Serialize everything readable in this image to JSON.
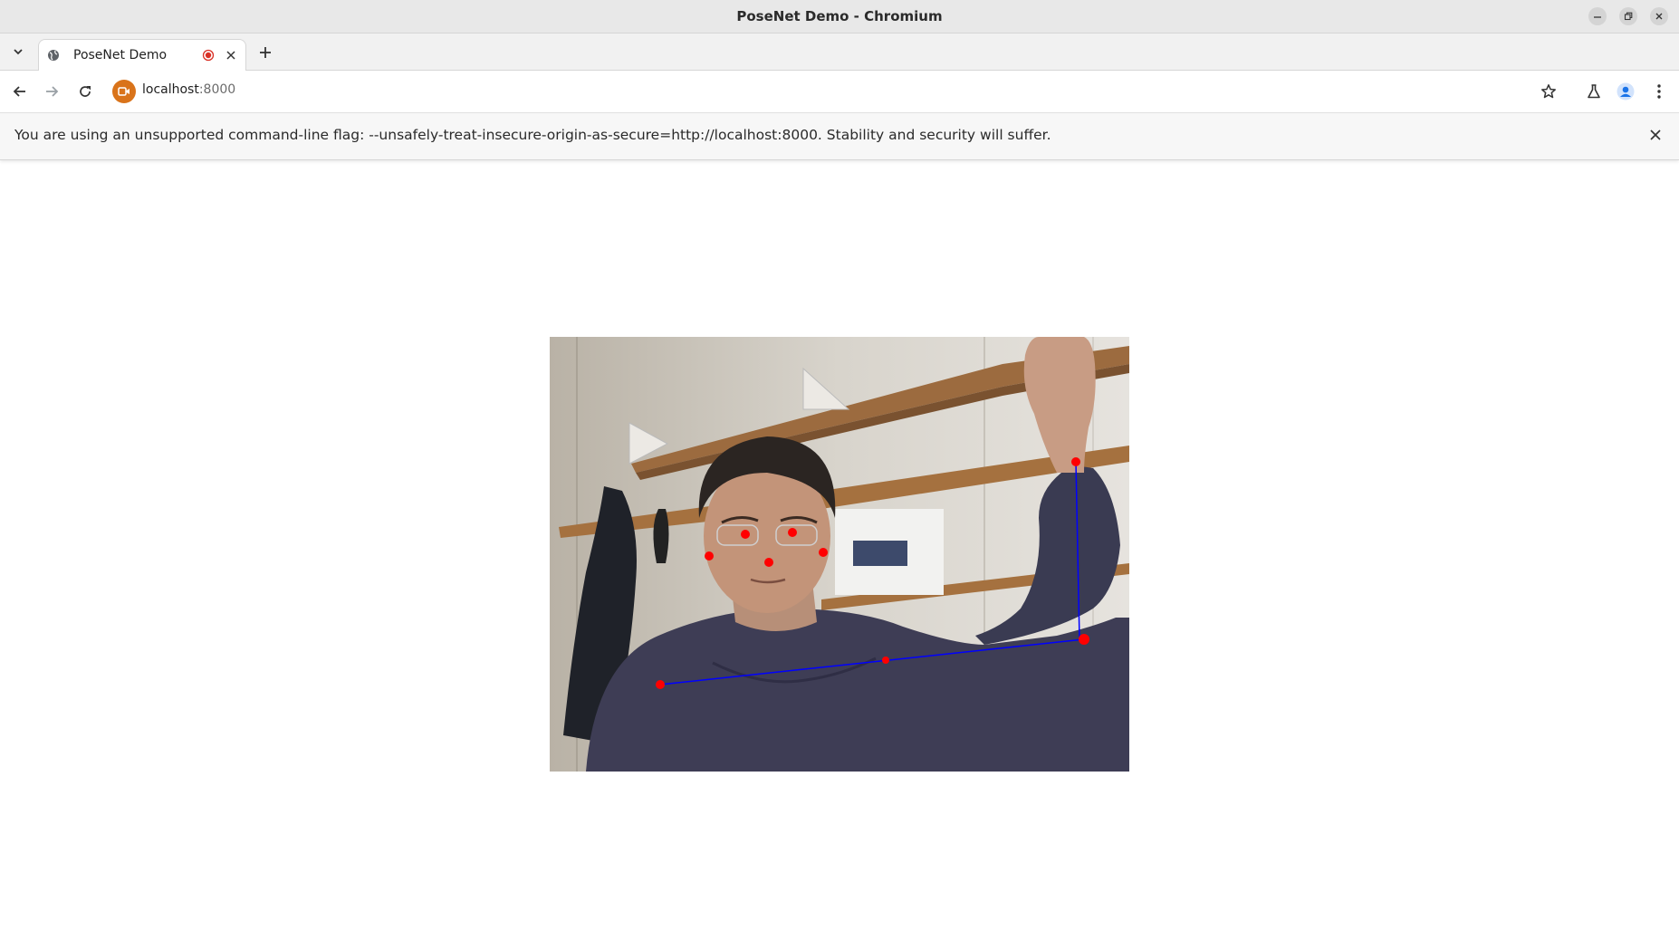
{
  "window": {
    "title": "PoseNet Demo - Chromium",
    "controls": [
      "minimize",
      "restore",
      "close"
    ]
  },
  "tabs": [
    {
      "title": "PoseNet Demo",
      "recording": true,
      "active": true
    }
  ],
  "toolbar": {
    "url_host": "localhost",
    "url_port": ":8000"
  },
  "infobar": {
    "message": "You are using an unsupported command-line flag: --unsafely-treat-insecure-origin-as-secure=http://localhost:8000. Stability and security will suffer."
  },
  "pose_overlay": {
    "keypoint_color": "#ff0000",
    "skeleton_color": "#0000ff"
  },
  "colors": {
    "accent": "#d9731a",
    "profile": "#1a73e8"
  }
}
